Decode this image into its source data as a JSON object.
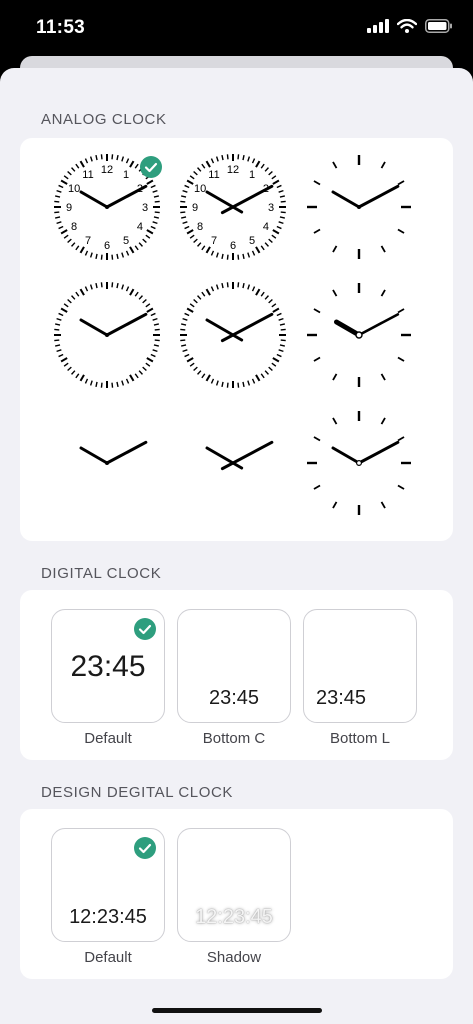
{
  "status": {
    "time": "11:53"
  },
  "sections": {
    "analog": {
      "title": "ANALOG CLOCK"
    },
    "digital": {
      "title": "DIGITAL CLOCK",
      "tiles": [
        {
          "time": "23:45",
          "label": "Default",
          "selected": true
        },
        {
          "time": "23:45",
          "label": "Bottom C",
          "selected": false
        },
        {
          "time": "23:45",
          "label": "Bottom L",
          "selected": false
        }
      ]
    },
    "design": {
      "title": "DESIGN DEGITAL CLOCK",
      "tiles": [
        {
          "time": "12:23:45",
          "label": "Default",
          "selected": true
        },
        {
          "time": "12:23:45",
          "label": "Shadow",
          "selected": false
        }
      ]
    }
  },
  "analog_clocks": {
    "numbers": [
      "12",
      "1",
      "2",
      "3",
      "4",
      "5",
      "6",
      "7",
      "8",
      "9",
      "10",
      "11"
    ],
    "selected_index": 0
  },
  "colors": {
    "accent": "#2e9e7e",
    "background": "#f1f1f6",
    "card": "#ffffff"
  },
  "icons": [
    "signal-icon",
    "wifi-icon",
    "battery-icon",
    "check-icon"
  ]
}
